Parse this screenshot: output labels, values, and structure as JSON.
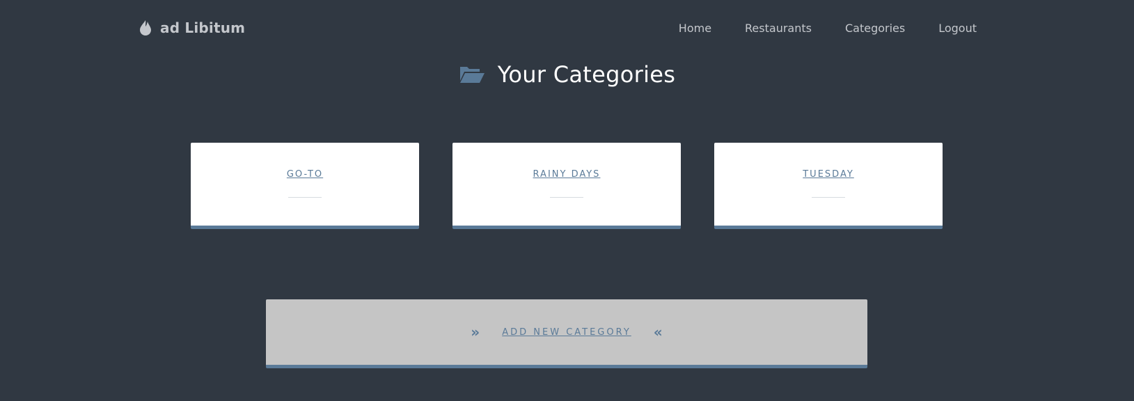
{
  "nav": {
    "brand": "ad Libitum",
    "items": [
      "Home",
      "Restaurants",
      "Categories",
      "Logout"
    ]
  },
  "page": {
    "title": "Your Categories",
    "icon": "folder-open-icon"
  },
  "categories": [
    "GO-TO",
    "RAINY DAYS",
    "TUESDAY"
  ],
  "add_button": {
    "label": "ADD NEW CATEGORY",
    "left_icon": "»",
    "right_icon": "«"
  },
  "colors": {
    "background": "#303842",
    "accent": "#5a7a98",
    "card": "#ffffff",
    "button": "#c5c5c5",
    "nav_text": "#c4c7cc"
  }
}
